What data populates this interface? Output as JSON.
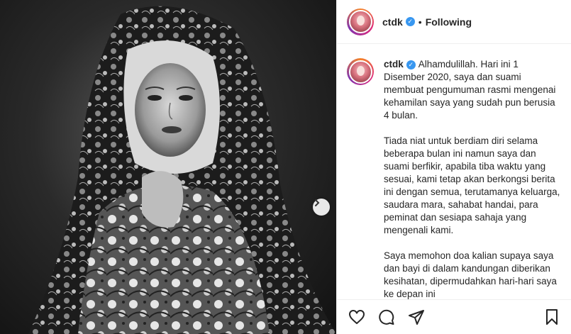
{
  "post": {
    "username": "ctdk",
    "separator": "•",
    "follow_status": "Following",
    "caption_paragraphs": [
      "Alhamdulillah. Hari ini 1 Disember 2020, saya dan suami membuat pengumuman rasmi mengenai kehamilan saya yang sudah pun berusia 4 bulan.",
      "Tiada niat untuk berdiam diri selama beberapa bulan ini namun saya dan suami berfikir, apabila tiba waktu yang sesuai, kami tetap akan berkongsi berita ini dengan semua, terutamanya keluarga, saudara mara, sahabat handai, para peminat dan sesiapa sahaja yang mengenali kami.",
      "Saya memohon doa kalian supaya saya dan bayi di dalam kandungan diberikan kesihatan, dipermudahkan hari-hari saya ke depan ini"
    ]
  },
  "icons": {
    "verified": "verified-badge-icon",
    "next": "chevron-right-icon",
    "like": "heart-icon",
    "comment": "comment-icon",
    "share": "paper-plane-icon",
    "save": "bookmark-icon"
  },
  "colors": {
    "verified": "#3897f0",
    "text": "#262626",
    "border": "#efefef"
  }
}
